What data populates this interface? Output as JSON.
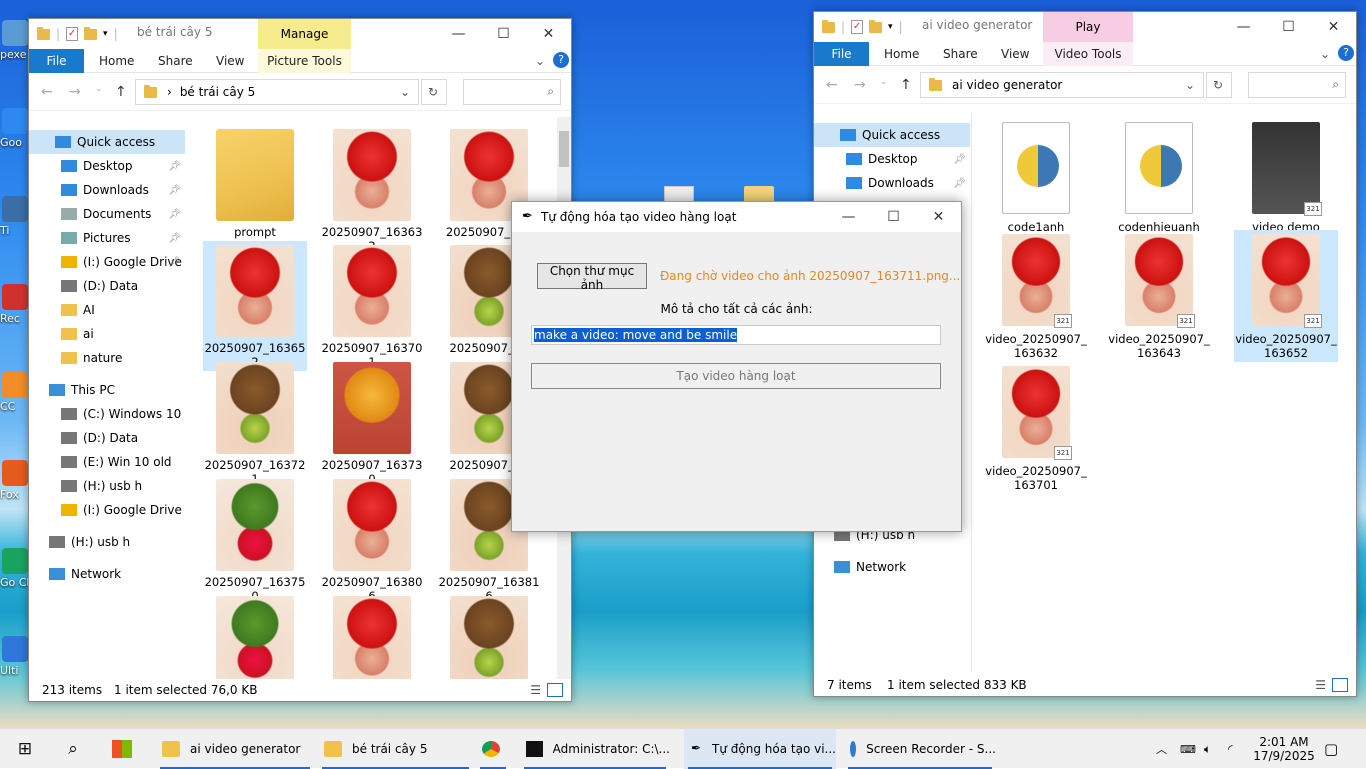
{
  "desktop": {
    "icons": [
      "pexe",
      "Goo",
      "Ti",
      "Rec",
      "CC",
      "Fox",
      "Go Ch",
      "Ulti"
    ]
  },
  "left_window": {
    "title": "bé trái cây 5",
    "context_tab": "Manage",
    "ribbon": {
      "file": "File",
      "home": "Home",
      "share": "Share",
      "view": "View",
      "context_sub": "Picture Tools"
    },
    "address": "bé trái cây 5",
    "nav": [
      {
        "label": "Quick access",
        "pinned": false
      },
      {
        "label": "Desktop",
        "pinned": true
      },
      {
        "label": "Downloads",
        "pinned": true
      },
      {
        "label": "Documents",
        "pinned": true
      },
      {
        "label": "Pictures",
        "pinned": true
      },
      {
        "label": "(I:) Google Drive",
        "pinned": true
      },
      {
        "label": "(D:) Data",
        "pinned": false
      },
      {
        "label": "AI",
        "pinned": false
      },
      {
        "label": "ai",
        "pinned": false
      },
      {
        "label": "nature",
        "pinned": false
      },
      {
        "label": "This PC",
        "pinned": false
      },
      {
        "label": "(C:) Windows 10",
        "pinned": false
      },
      {
        "label": "(D:) Data",
        "pinned": false
      },
      {
        "label": "(E:) Win 10 old",
        "pinned": false
      },
      {
        "label": "(H:) usb h",
        "pinned": false
      },
      {
        "label": "(I:) Google Drive",
        "pinned": false
      },
      {
        "label": "(H:) usb h",
        "pinned": false
      },
      {
        "label": "Network",
        "pinned": false
      }
    ],
    "files": [
      {
        "name": "prompt",
        "kind": "folder"
      },
      {
        "name": "20250907_163632",
        "kind": "straw"
      },
      {
        "name": "20250907_163",
        "kind": "straw"
      },
      {
        "name": "20250907_163652",
        "kind": "straw",
        "selected": true
      },
      {
        "name": "20250907_163701",
        "kind": "straw"
      },
      {
        "name": "20250907_16",
        "kind": "kiwi"
      },
      {
        "name": "20250907_163721",
        "kind": "kiwi"
      },
      {
        "name": "20250907_163730",
        "kind": "mango"
      },
      {
        "name": "20250907_16",
        "kind": "kiwi"
      },
      {
        "name": "20250907_163750",
        "kind": "melon"
      },
      {
        "name": "20250907_163806",
        "kind": "straw"
      },
      {
        "name": "20250907_163816",
        "kind": "kiwi"
      },
      {
        "name": "",
        "kind": "melon"
      },
      {
        "name": "",
        "kind": "straw"
      },
      {
        "name": "",
        "kind": "kiwi"
      }
    ],
    "status": {
      "count": "213 items",
      "selected": "1 item selected  76,0 KB"
    }
  },
  "right_window": {
    "title": "ai video generator",
    "context_tab": "Play",
    "ribbon": {
      "file": "File",
      "home": "Home",
      "share": "Share",
      "view": "View",
      "context_sub": "Video Tools"
    },
    "address": "ai video generator",
    "nav": [
      {
        "label": "Quick access",
        "pinned": false
      },
      {
        "label": "Desktop",
        "pinned": true
      },
      {
        "label": "Downloads",
        "pinned": true
      },
      {
        "label": "(H:) usb h",
        "pinned": false
      },
      {
        "label": "Network",
        "pinned": false
      }
    ],
    "files": [
      {
        "name": "code1anh",
        "kind": "py"
      },
      {
        "name": "codenhieuanh",
        "kind": "py"
      },
      {
        "name": "video demo",
        "kind": "video"
      },
      {
        "name": "video_20250907_163632",
        "kind": "straw",
        "overlay": "321"
      },
      {
        "name": "video_20250907_163643",
        "kind": "straw",
        "overlay": "321"
      },
      {
        "name": "video_20250907_163652",
        "kind": "straw",
        "overlay": "321",
        "selected": true
      },
      {
        "name": "video_20250907_163701",
        "kind": "straw",
        "overlay": "321"
      }
    ],
    "status": {
      "count": "7 items",
      "selected": "1 item selected  833 KB"
    }
  },
  "dialog": {
    "title": "Tự động hóa tạo video hàng loạt",
    "choose_button": "Chọn thư mục ảnh",
    "status_text": "Đang chờ video cho ảnh 20250907_163711.png...",
    "status_color": "#e8871e",
    "prompt_label": "Mô tả cho tất cả các ảnh:",
    "prompt_value": "make a video: move and be smile",
    "run_button": "Tạo video hàng loạt"
  },
  "taskbar": {
    "items": [
      {
        "label": "ai video generator",
        "icon": "folder-icon"
      },
      {
        "label": "bé trái cây 5",
        "icon": "folder-icon"
      },
      {
        "label": "",
        "icon": "chrome-icon"
      },
      {
        "label": "Administrator: C:\\...",
        "icon": "terminal-icon"
      },
      {
        "label": "Tự động hóa tạo vi...",
        "icon": "feather-icon"
      },
      {
        "label": "Screen Recorder - S...",
        "icon": "recorder-icon"
      }
    ],
    "time": "2:01 AM",
    "date": "17/9/2025"
  }
}
